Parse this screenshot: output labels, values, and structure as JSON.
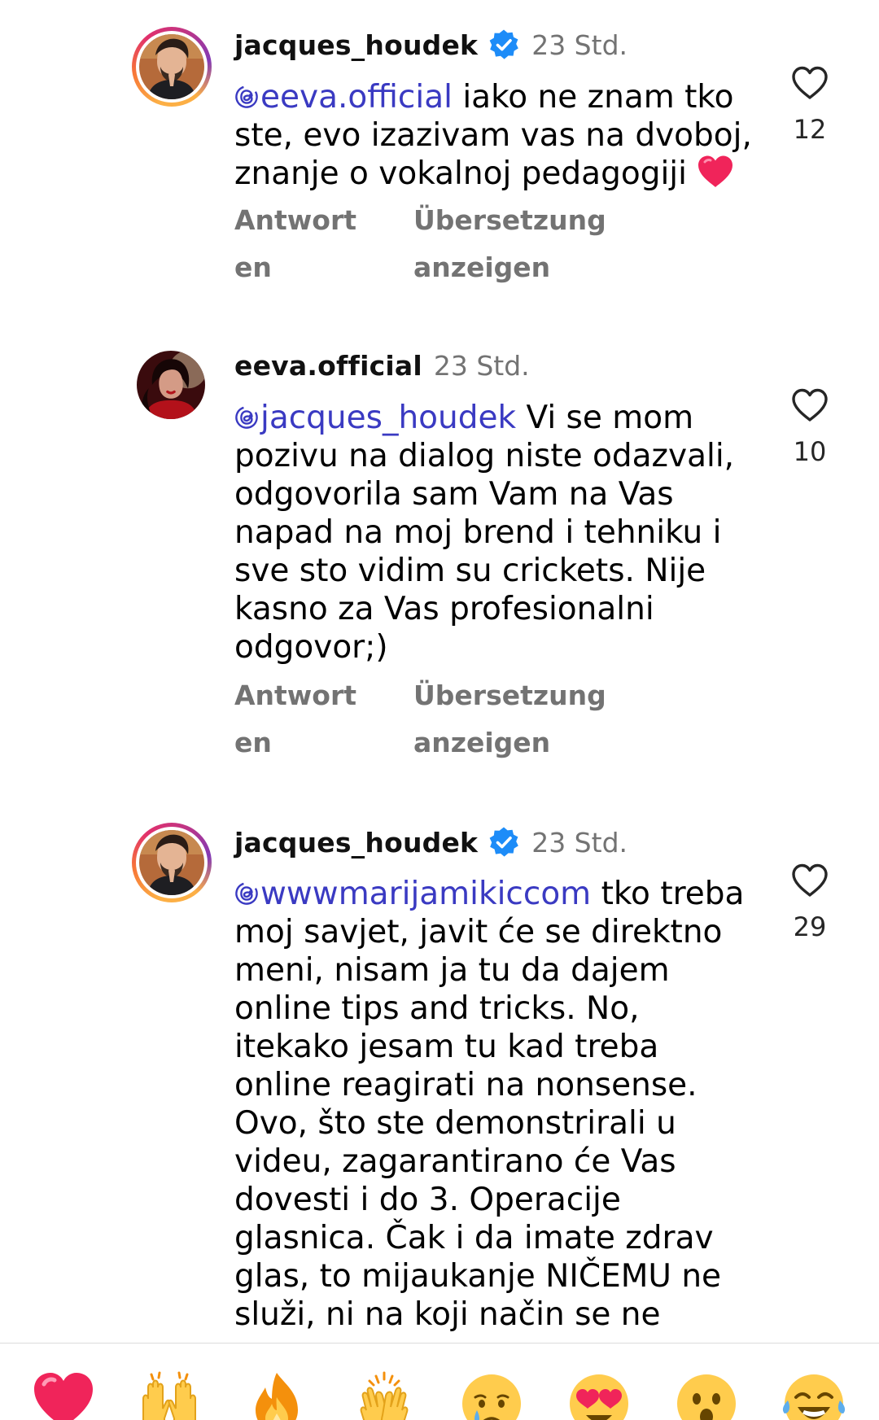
{
  "comments": [
    {
      "username": "jacques_houdek",
      "verified": true,
      "time": "23 Std.",
      "mention": "eeva.official",
      "text": " iako ne znam tko ste, evo izazivam vas na dvoboj, znanje o vokalnoj pedagogiji ",
      "trailing_emoji": "red-heart",
      "likes": "12",
      "reply_label": "Antworten",
      "translate_label": "Übersetzung anzeigen",
      "avatar": "jacques-avatar"
    },
    {
      "username": "eeva.official",
      "verified": false,
      "time": "23 Std.",
      "mention": "jacques_houdek",
      "text": " Vi se mom pozivu na dialog niste odazvali, odgovorila sam Vam na Vas napad na moj brend i tehniku i sve sto vidim su crickets. Nije kasno za Vas profesionalni odgovor;)",
      "likes": "10",
      "reply_label": "Antworten",
      "translate_label": "Übersetzung anzeigen",
      "avatar": "eeva-avatar"
    },
    {
      "username": "jacques_houdek",
      "verified": true,
      "time": "23 Std.",
      "mention": "wwwmarijamikiccom",
      "text": " tko treba moj savjet, javit će se direktno meni, nisam ja tu da dajem online tips and tricks. No, itekako jesam tu kad treba online reagirati na nonsense. Ovo, što ste demonstrirali u videu, zagarantirano će Vas dovesti i do 3. Operacije glasnica. Čak i da imate zdrav glas, to mijaukanje NIČEMU ne služi, ni na koji način se ne može",
      "likes": "29",
      "avatar": "jacques-avatar"
    }
  ],
  "emoji_bar": [
    {
      "name": "red-heart-emoji"
    },
    {
      "name": "raising-hands-emoji"
    },
    {
      "name": "fire-emoji"
    },
    {
      "name": "clapping-hands-emoji"
    },
    {
      "name": "crying-face-emoji"
    },
    {
      "name": "heart-eyes-emoji"
    },
    {
      "name": "surprised-face-emoji"
    },
    {
      "name": "tears-of-joy-emoji"
    }
  ],
  "colors": {
    "mention": "#3a3ac2",
    "meta": "#737373",
    "verified": "#1d8cf8",
    "heart": "#f0245a"
  }
}
